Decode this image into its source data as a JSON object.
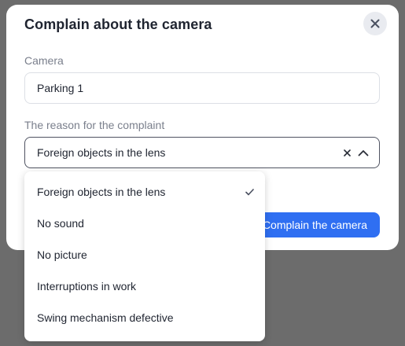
{
  "modal": {
    "title": "Complain about the camera",
    "camera_label": "Camera",
    "camera_value": "Parking 1",
    "reason_label": "The reason for the complaint",
    "reason_selected": "Foreign objects in the lens",
    "submit_label": "Complain the camera",
    "accent_color": "#2f6ff2"
  },
  "dropdown": {
    "items": [
      {
        "label": "Foreign objects in the lens",
        "selected": true
      },
      {
        "label": "No sound",
        "selected": false
      },
      {
        "label": "No picture",
        "selected": false
      },
      {
        "label": "Interruptions in work",
        "selected": false
      },
      {
        "label": "Swing mechanism defective",
        "selected": false
      }
    ]
  },
  "icons": [
    "close-icon",
    "clear-icon",
    "chevron-up-icon",
    "check-icon"
  ]
}
